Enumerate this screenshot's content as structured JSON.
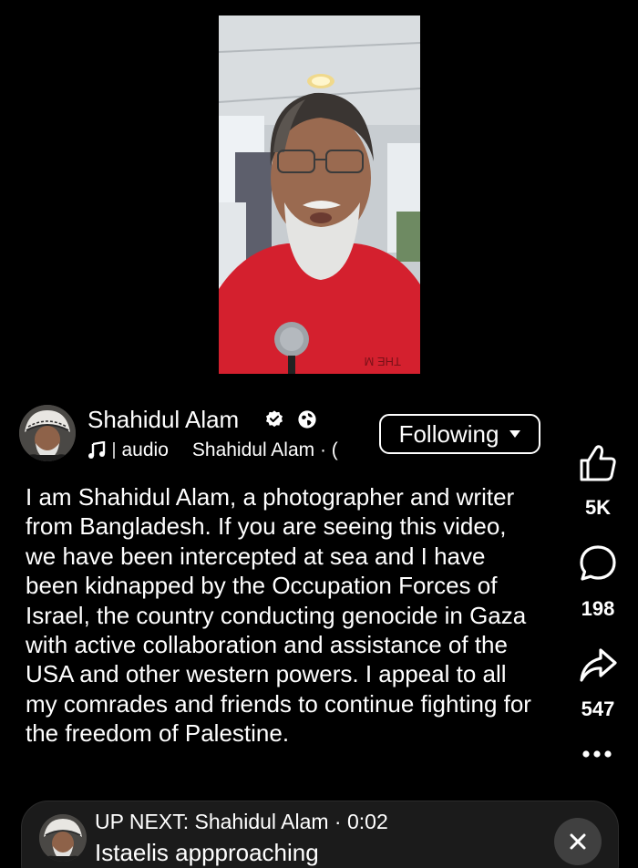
{
  "post": {
    "author": "Shahidul Alam",
    "audio_label": "audio",
    "audio_artist": "Shahidul Alam · (",
    "follow_label": "Following",
    "caption": "I am Shahidul Alam, a photographer and writer from Bangladesh. If you are seeing this video, we have been intercepted at sea and I have been kidnapped by the Occupation Forces of Israel, the country conducting genocide in Gaza with active collaboration and assistance of the USA and other western powers. I appeal to all my comrades and friends to continue fighting for the freedom of Palestine."
  },
  "actions": {
    "likes": "5K",
    "comments": "198",
    "shares": "547"
  },
  "up_next": {
    "title": "UP NEXT: Shahidul Alam · 0:02",
    "subtitle": "Istaelis appproaching"
  },
  "video": {
    "shirt_text": "THE M"
  },
  "icons": [
    "verified-badge-icon",
    "globe-icon",
    "music-note-icon",
    "chevron-down-icon",
    "thumbs-up-icon",
    "comment-icon",
    "share-icon",
    "more-icon",
    "close-icon"
  ],
  "colors": {
    "background": "#000000",
    "text": "#ffffff",
    "upnext_bg": "#1b1b1b",
    "close_bg": "#404040"
  }
}
